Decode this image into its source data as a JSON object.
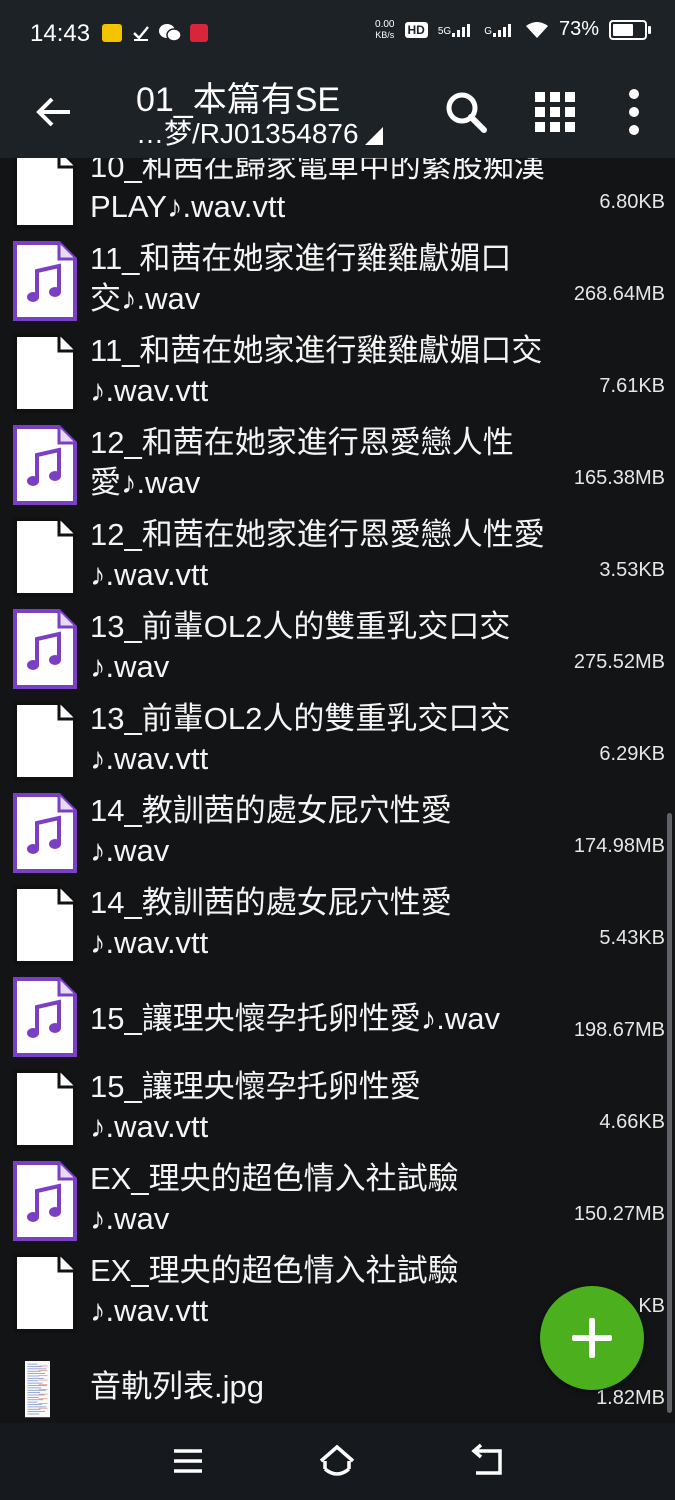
{
  "status_bar": {
    "time": "14:43",
    "net_speed_top": "0.00",
    "net_speed_bottom": "KB/s",
    "hd": "HD",
    "sig1": "5G",
    "sig2": "G",
    "battery_text": "73%",
    "battery_level": 0.73
  },
  "app_bar": {
    "title": "01_本篇有SE",
    "subtitle": "…梦/RJ01354876"
  },
  "files": [
    {
      "name_line1": "10_和茜在歸家電車中的緊股痴漢",
      "name_line2": "PLAY♪.wav.vtt",
      "size": "6.80KB",
      "type": "document-icon"
    },
    {
      "name_line1": "11_和茜在她家進行雞雞獻媚口",
      "name_line2": "交♪.wav",
      "size": "268.64MB",
      "type": "audio-icon"
    },
    {
      "name_line1": "11_和茜在她家進行雞雞獻媚口交",
      "name_line2": "♪.wav.vtt",
      "size": "7.61KB",
      "type": "document-icon"
    },
    {
      "name_line1": "12_和茜在她家進行恩愛戀人性",
      "name_line2": "愛♪.wav",
      "size": "165.38MB",
      "type": "audio-icon"
    },
    {
      "name_line1": "12_和茜在她家進行恩愛戀人性愛",
      "name_line2": "♪.wav.vtt",
      "size": "3.53KB",
      "type": "document-icon"
    },
    {
      "name_line1": "13_前輩OL2人的雙重乳交口交",
      "name_line2": "♪.wav",
      "size": "275.52MB",
      "type": "audio-icon"
    },
    {
      "name_line1": "13_前輩OL2人的雙重乳交口交",
      "name_line2": "♪.wav.vtt",
      "size": "6.29KB",
      "type": "document-icon"
    },
    {
      "name_line1": "14_教訓茜的處女屁穴性愛",
      "name_line2": "♪.wav",
      "size": "174.98MB",
      "type": "audio-icon"
    },
    {
      "name_line1": "14_教訓茜的處女屁穴性愛",
      "name_line2": "♪.wav.vtt",
      "size": "5.43KB",
      "type": "document-icon"
    },
    {
      "name_line1": "15_讓理央懷孕托卵性愛♪.wav",
      "name_line2": "",
      "size": "198.67MB",
      "type": "audio-icon"
    },
    {
      "name_line1": "15_讓理央懷孕托卵性愛",
      "name_line2": "♪.wav.vtt",
      "size": "4.66KB",
      "type": "document-icon"
    },
    {
      "name_line1": "EX_理央的超色情入社試驗",
      "name_line2": "♪.wav",
      "size": "150.27MB",
      "type": "audio-icon"
    },
    {
      "name_line1": "EX_理央的超色情入社試驗",
      "name_line2": "♪.wav.vtt",
      "size": "KB",
      "type": "document-icon"
    },
    {
      "name_line1": "音軌列表.jpg",
      "name_line2": "",
      "size": "1.82MB",
      "type": "image-thumbnail"
    }
  ]
}
